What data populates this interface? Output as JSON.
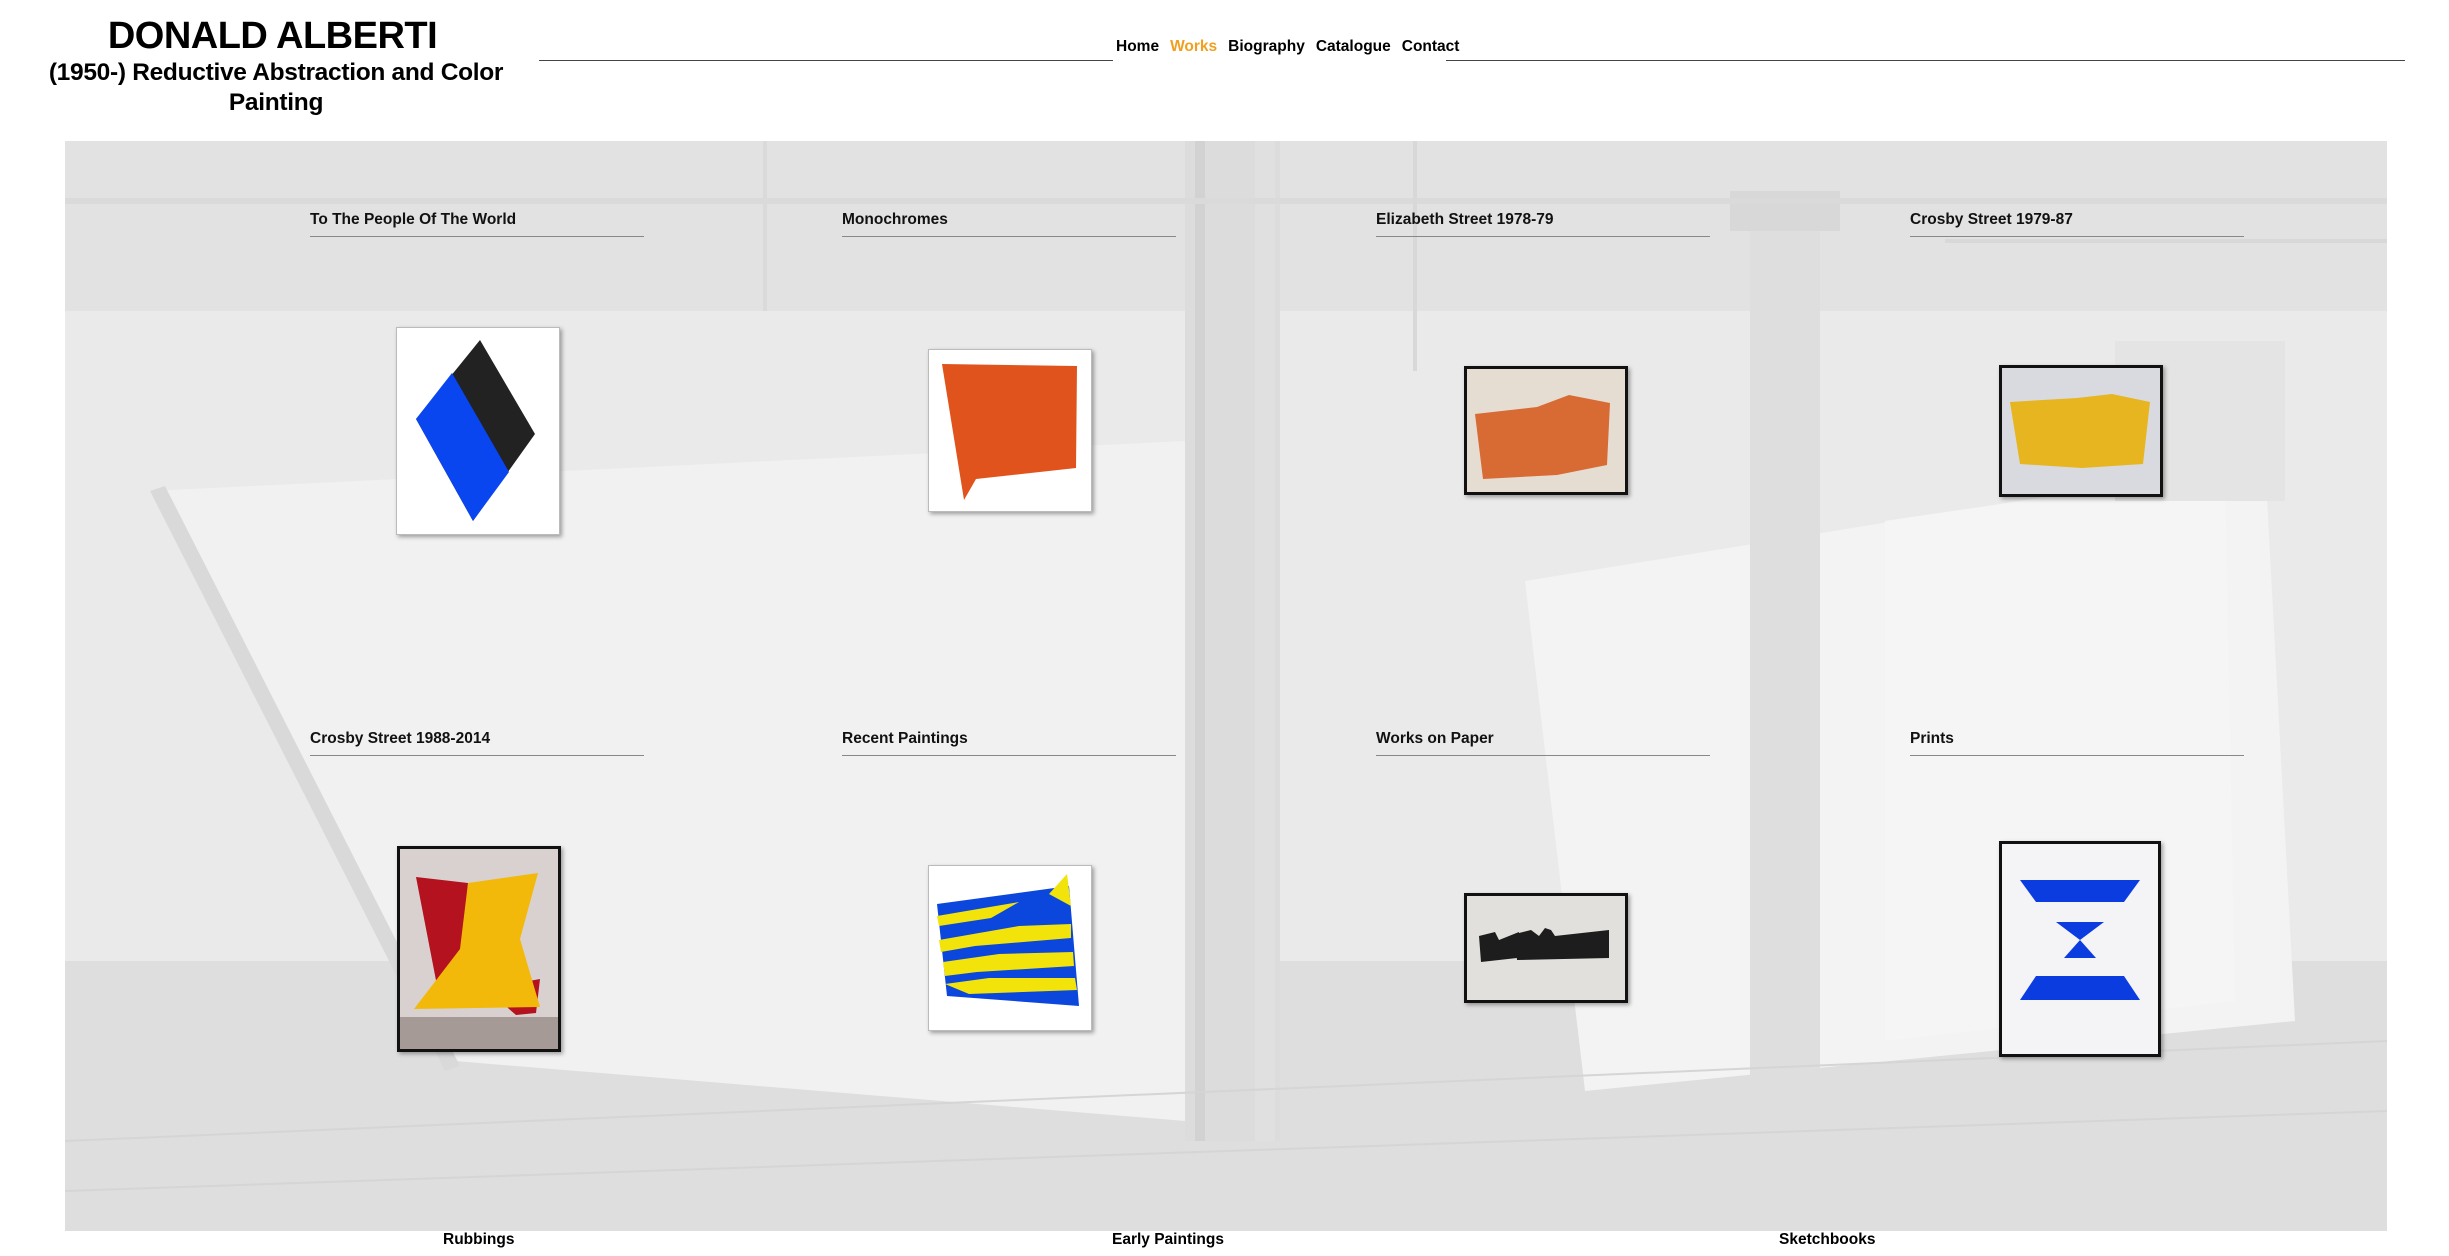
{
  "header": {
    "title": "DONALD ALBERTI",
    "subtitle": "(1950-) Reductive Abstraction and Color Painting"
  },
  "nav": {
    "items": [
      "Home",
      "Works",
      "Biography",
      "Catalogue",
      "Contact"
    ],
    "active": "Works"
  },
  "colors": {
    "active_nav": "#f0a020",
    "gallery_bg": "#ededed"
  },
  "categories": [
    {
      "label": "To The People Of The World",
      "icon": "blue-black-diamond-painting"
    },
    {
      "label": "Monochromes",
      "icon": "orange-monochrome-painting"
    },
    {
      "label": "Elizabeth Street 1978-79",
      "icon": "orange-shaped-painting-photo"
    },
    {
      "label": "Crosby Street 1979-87",
      "icon": "yellow-shaped-painting-photo"
    },
    {
      "label": "Crosby Street 1988-2014",
      "icon": "red-yellow-painting-photo"
    },
    {
      "label": "Recent Paintings",
      "icon": "blue-yellow-stripe-painting"
    },
    {
      "label": "Works on Paper",
      "icon": "black-shapes-on-paper"
    },
    {
      "label": "Prints",
      "icon": "blue-hourglass-print"
    }
  ],
  "footer": {
    "links": [
      "Rubbings",
      "Early Paintings",
      "Sketchbooks"
    ]
  }
}
